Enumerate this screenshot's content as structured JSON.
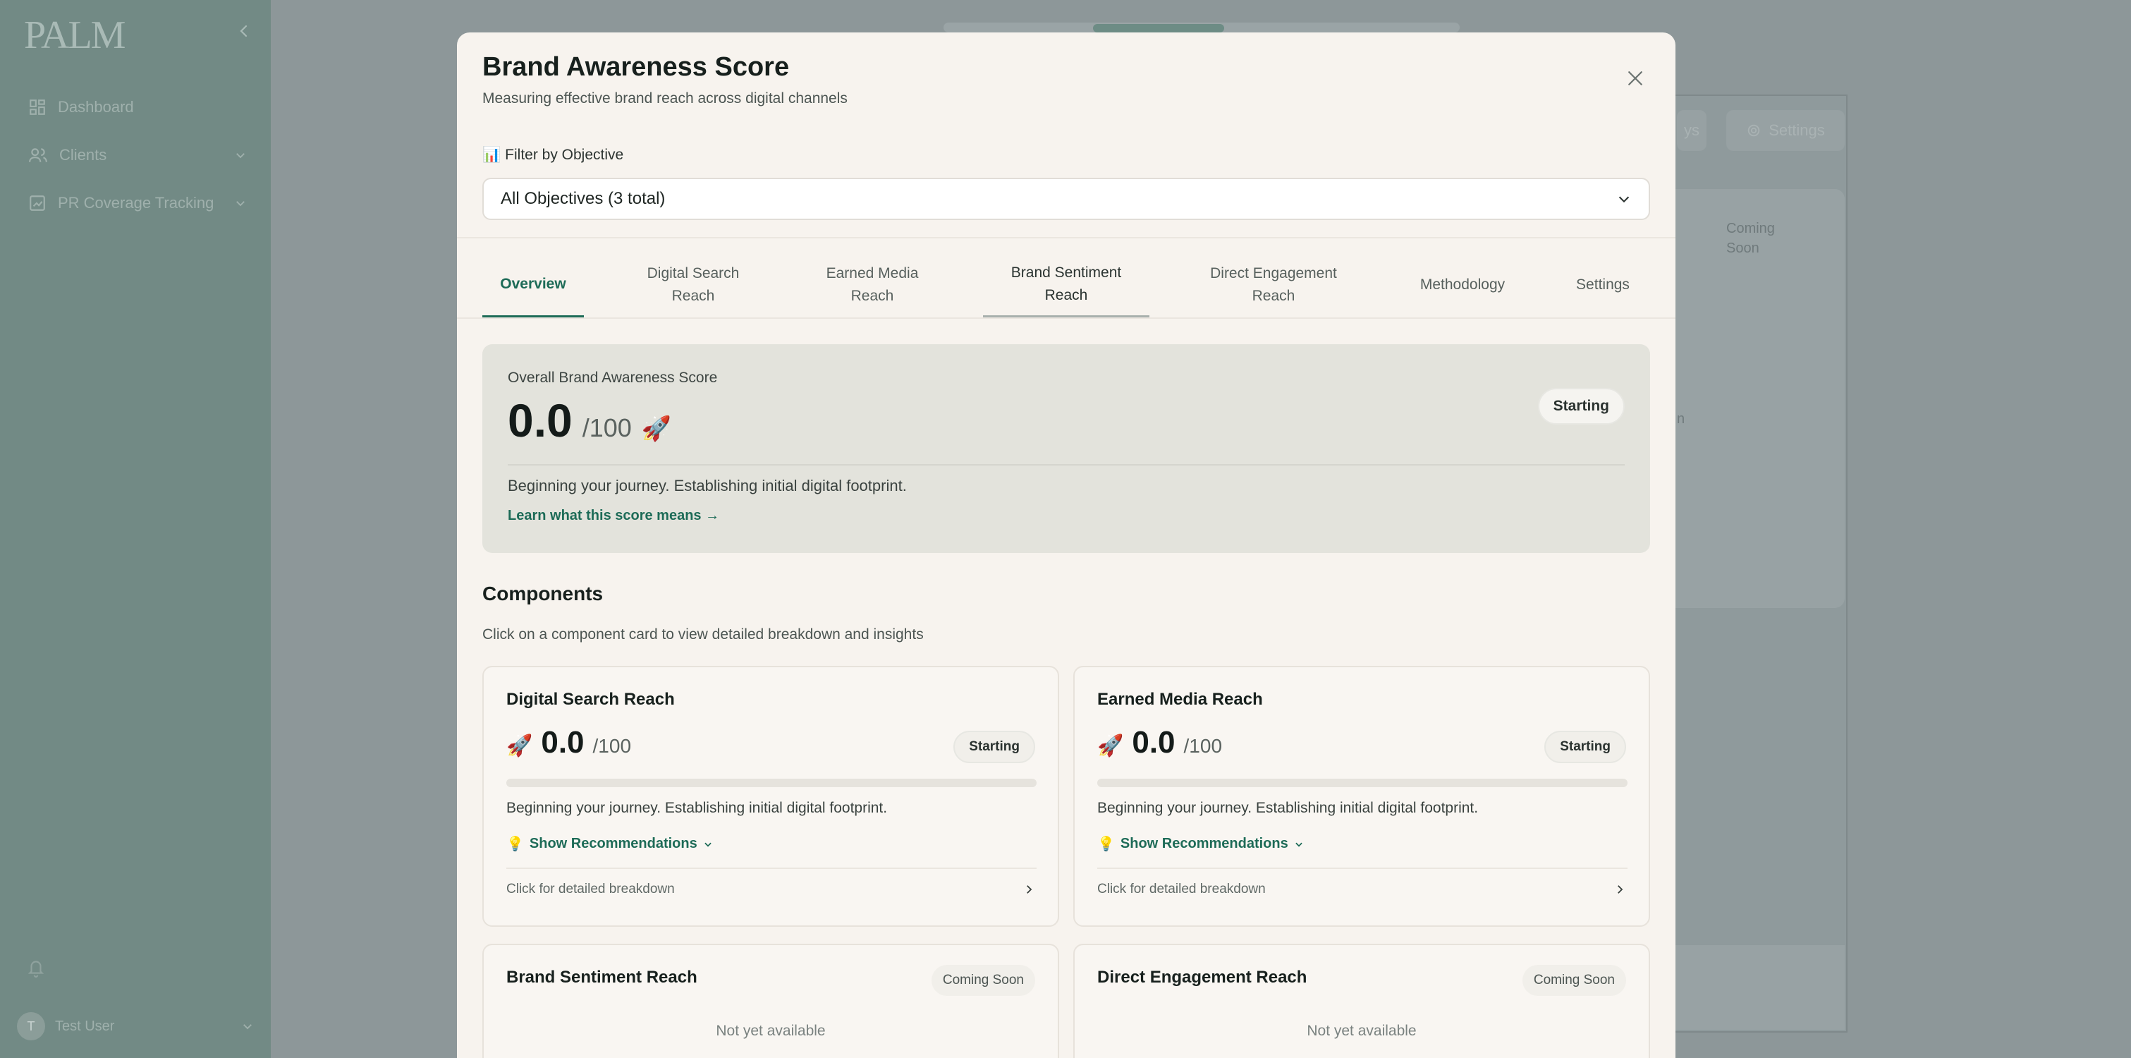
{
  "sidebar": {
    "logo": "PALM",
    "items": [
      {
        "label": "Dashboard",
        "icon": "grid-icon"
      },
      {
        "label": "Clients",
        "icon": "users-icon"
      },
      {
        "label": "PR Coverage Tracking",
        "icon": "chart-icon"
      }
    ],
    "user": {
      "initial": "T",
      "name": "Test User"
    }
  },
  "background": {
    "buttons": [
      {
        "label": "ys"
      },
      {
        "label": "Settings"
      }
    ],
    "coming_soon": "Coming\nSoon",
    "stray_letter": "n"
  },
  "modal": {
    "title": "Brand Awareness Score",
    "subtitle": "Measuring effective brand reach across digital channels",
    "filter": {
      "label": "Filter by Objective",
      "icon": "📊",
      "value": "All Objectives (3 total)"
    },
    "tabs": [
      {
        "label": "Overview"
      },
      {
        "label": "Digital Search\nReach"
      },
      {
        "label": "Earned Media\nReach"
      },
      {
        "label": "Brand Sentiment\nReach"
      },
      {
        "label": "Direct Engagement\nReach"
      },
      {
        "label": "Methodology"
      },
      {
        "label": "Settings"
      }
    ],
    "score": {
      "label": "Overall Brand Awareness Score",
      "value": "0.0",
      "max": "/100",
      "emoji": "🚀",
      "status": "Starting",
      "description": "Beginning your journey. Establishing initial digital footprint.",
      "link": "Learn what this score means →"
    },
    "components": {
      "title": "Components",
      "subtitle": "Click on a component card to view detailed breakdown and insights",
      "cards": [
        {
          "title": "Digital Search Reach",
          "emoji": "🚀",
          "value": "0.0",
          "max": "/100",
          "status": "Starting",
          "progress": 0,
          "description": "Beginning your journey. Establishing initial digital footprint.",
          "recs_icon": "💡",
          "recs": "Show Recommendations",
          "footer": "Click for detailed breakdown"
        },
        {
          "title": "Earned Media Reach",
          "emoji": "🚀",
          "value": "0.0",
          "max": "/100",
          "status": "Starting",
          "progress": 0,
          "description": "Beginning your journey. Establishing initial digital footprint.",
          "recs_icon": "💡",
          "recs": "Show Recommendations",
          "footer": "Click for detailed breakdown"
        },
        {
          "title": "Brand Sentiment Reach",
          "status": "Coming Soon",
          "note": "Not yet available"
        },
        {
          "title": "Direct Engagement Reach",
          "status": "Coming Soon",
          "note": "Not yet available"
        }
      ]
    }
  },
  "colors": {
    "accent": "#1d6b57",
    "sidebar": "#728a85",
    "modal_bg": "#f7f3ee"
  }
}
